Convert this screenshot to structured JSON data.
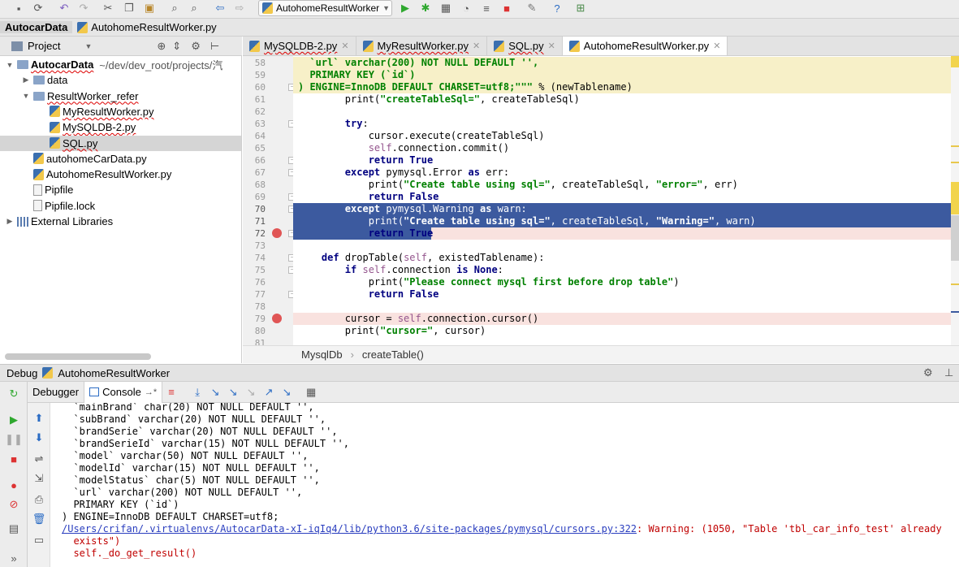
{
  "toolbar": {
    "run_config": "AutohomeResultWorker"
  },
  "breadcrumb": {
    "project": "AutocarData",
    "file": "AutohomeResultWorker.py"
  },
  "project_panel": {
    "title": "Project"
  },
  "tree": [
    {
      "label": "AutocarData",
      "suffix": "~/dev/dev_root/projects/汽",
      "indent": 0,
      "type": "root",
      "arrow": "▼"
    },
    {
      "label": "data",
      "indent": 1,
      "type": "folder",
      "arrow": "▶"
    },
    {
      "label": "ResultWorker_refer",
      "indent": 1,
      "type": "folder",
      "arrow": "▼"
    },
    {
      "label": "MyResultWorker.py",
      "indent": 2,
      "type": "py"
    },
    {
      "label": "MySQLDB-2.py",
      "indent": 2,
      "type": "py"
    },
    {
      "label": "SQL.py",
      "indent": 2,
      "type": "py",
      "selected": true
    },
    {
      "label": "autohomeCarData.py",
      "indent": 1,
      "type": "py"
    },
    {
      "label": "AutohomeResultWorker.py",
      "indent": 1,
      "type": "py"
    },
    {
      "label": "Pipfile",
      "indent": 1,
      "type": "file"
    },
    {
      "label": "Pipfile.lock",
      "indent": 1,
      "type": "file"
    },
    {
      "label": "External Libraries",
      "indent": 0,
      "type": "lib",
      "arrow": "▶"
    }
  ],
  "tabs": [
    {
      "label": "MySQLDB-2.py",
      "active": false
    },
    {
      "label": "MyResultWorker.py",
      "active": false
    },
    {
      "label": "SQL.py",
      "active": false
    },
    {
      "label": "AutohomeResultWorker.py",
      "active": true
    }
  ],
  "editor": {
    "lines": [
      {
        "n": "58",
        "hl": "doc",
        "html": "<span class=\"str\">  `url` varchar(200) NOT NULL DEFAULT '',</span>"
      },
      {
        "n": "59",
        "hl": "doc",
        "html": "<span class=\"str\">  PRIMARY KEY (`id`)</span>"
      },
      {
        "n": "60",
        "hl": "doc",
        "html": "<span class=\"str\">) ENGINE=InnoDB DEFAULT CHARSET=utf8;\"\"\"</span> % (newTablename)"
      },
      {
        "n": "61",
        "hl": "",
        "html": "        print(<span class=\"str\">\"createTableSql=\"</span>, createTableSql)"
      },
      {
        "n": "62",
        "hl": "",
        "html": ""
      },
      {
        "n": "63",
        "hl": "",
        "html": "        <span class=\"kw\">try</span>:"
      },
      {
        "n": "64",
        "hl": "",
        "html": "            cursor.execute(createTableSql)"
      },
      {
        "n": "65",
        "hl": "",
        "html": "            <span class=\"self\">self</span>.connection.commit()"
      },
      {
        "n": "66",
        "hl": "",
        "html": "            <span class=\"kw\">return True</span>"
      },
      {
        "n": "67",
        "hl": "",
        "html": "        <span class=\"kw\">except</span> pymysql.Error <span class=\"kw\">as</span> err:"
      },
      {
        "n": "68",
        "hl": "",
        "html": "            print(<span class=\"str\">\"Create table using sql=\"</span>, createTableSql, <span class=\"str\">\"error=\"</span>, err)"
      },
      {
        "n": "69",
        "hl": "",
        "html": "            <span class=\"kw\">return False</span>"
      },
      {
        "n": "70",
        "hl": "sel",
        "html": "        <span class=\"kw\">except</span> pymysql.Warning <span class=\"kw\">as</span> warn:"
      },
      {
        "n": "71",
        "hl": "sel",
        "html": "            print(<span class=\"str\">\"Create table using sql=\"</span>, createTableSql, <span class=\"str\">\"Warning=\"</span>, warn)"
      },
      {
        "n": "72",
        "hl": "selbp",
        "html": "            <span class=\"kw\">return True</span>"
      },
      {
        "n": "73",
        "hl": "",
        "html": ""
      },
      {
        "n": "74",
        "hl": "",
        "html": "    <span class=\"kw\">def</span> dropTable(<span class=\"self\">self</span>, existedTablename):"
      },
      {
        "n": "75",
        "hl": "",
        "html": "        <span class=\"kw\">if</span> <span class=\"self\">self</span>.connection <span class=\"kw\">is None</span>:"
      },
      {
        "n": "76",
        "hl": "",
        "html": "            print(<span class=\"str\">\"Please connect mysql first before drop table\"</span>)"
      },
      {
        "n": "77",
        "hl": "",
        "html": "            <span class=\"kw\">return False</span>"
      },
      {
        "n": "78",
        "hl": "",
        "html": ""
      },
      {
        "n": "79",
        "hl": "bp",
        "html": "        cursor = <span class=\"self\">self</span>.connection.cursor()"
      },
      {
        "n": "80",
        "hl": "",
        "html": "        print(<span class=\"str\">\"cursor=\"</span>, cursor)"
      },
      {
        "n": "81",
        "hl": "",
        "html": ""
      }
    ],
    "crumb": [
      "MysqlDb",
      "createTable()"
    ]
  },
  "debug": {
    "label": "Debug",
    "config": "AutohomeResultWorker",
    "tab_debugger": "Debugger",
    "tab_console": "Console"
  },
  "console": [
    {
      "cls": "",
      "text": "  `mainBrand` char(20) NOT NULL DEFAULT '',"
    },
    {
      "cls": "",
      "text": "  `subBrand` varchar(20) NOT NULL DEFAULT '',"
    },
    {
      "cls": "",
      "text": "  `brandSerie` varchar(20) NOT NULL DEFAULT '',"
    },
    {
      "cls": "",
      "text": "  `brandSerieId` varchar(15) NOT NULL DEFAULT '',"
    },
    {
      "cls": "",
      "text": "  `model` varchar(50) NOT NULL DEFAULT '',"
    },
    {
      "cls": "",
      "text": "  `modelId` varchar(15) NOT NULL DEFAULT '',"
    },
    {
      "cls": "",
      "text": "  `modelStatus` char(5) NOT NULL DEFAULT '',"
    },
    {
      "cls": "",
      "text": "  `url` varchar(200) NOT NULL DEFAULT '',"
    },
    {
      "cls": "",
      "text": "  PRIMARY KEY (`id`)"
    },
    {
      "cls": "",
      "text": ") ENGINE=InnoDB DEFAULT CHARSET=utf8;"
    },
    {
      "cls": "err",
      "link": "/Users/crifan/.virtualenvs/AutocarData-xI-iqIq4/lib/python3.6/site-packages/pymysql/cursors.py:322",
      "text": ": Warning: (1050, \"Table 'tbl_car_info_test' already"
    },
    {
      "cls": "err",
      "text": "  exists\")"
    },
    {
      "cls": "err",
      "text": "  self._do_get_result()"
    }
  ]
}
